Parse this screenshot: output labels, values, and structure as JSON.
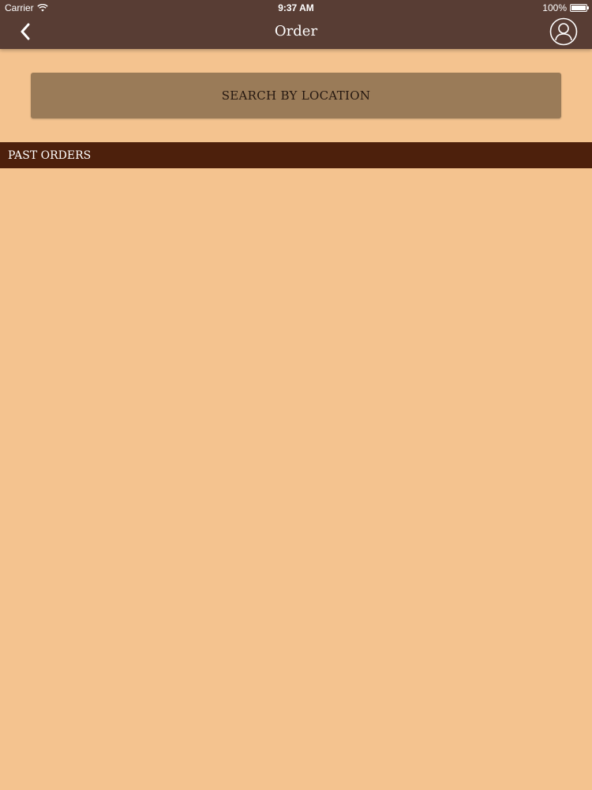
{
  "status_bar": {
    "carrier": "Carrier",
    "time": "9:37 AM",
    "battery": "100%"
  },
  "nav": {
    "title": "Order",
    "back_icon": "chevron-left-icon",
    "profile_icon": "user-icon"
  },
  "search": {
    "label": "SEARCH BY LOCATION"
  },
  "past_orders": {
    "header": "PAST ORDERS",
    "items": []
  },
  "colors": {
    "background": "#f4c38f",
    "nav_bar": "#583d34",
    "search_button": "#9a7b58",
    "section_header": "#4d200c"
  }
}
